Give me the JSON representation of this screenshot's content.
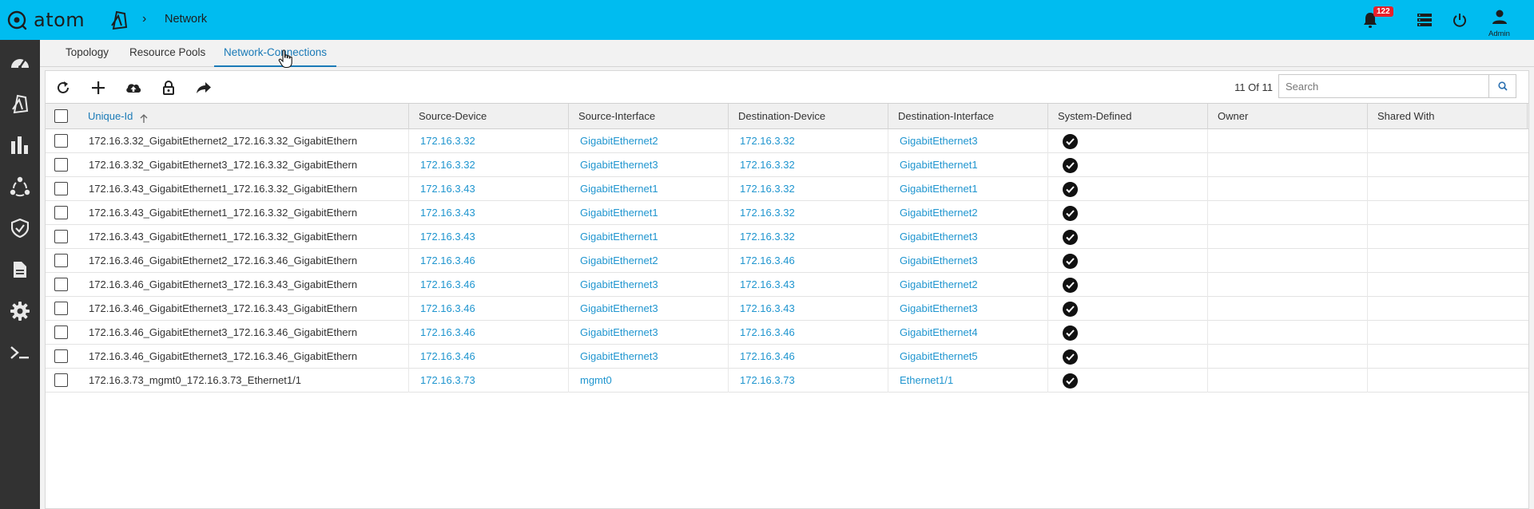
{
  "app": {
    "logo_text": "atom",
    "breadcrumb_current": "Network",
    "notification_count": "122",
    "user_label": "Admin"
  },
  "tabs": [
    {
      "label": "Topology",
      "active": false
    },
    {
      "label": "Resource Pools",
      "active": false
    },
    {
      "label": "Network-Connections",
      "active": true
    }
  ],
  "toolbar": {
    "count": "11 Of 11",
    "search_placeholder": "Search"
  },
  "table": {
    "columns": [
      "Unique-Id",
      "Source-Device",
      "Source-Interface",
      "Destination-Device",
      "Destination-Interface",
      "System-Defined",
      "Owner",
      "Shared With"
    ],
    "sorted_column": "Unique-Id",
    "rows": [
      {
        "uid": "172.16.3.32_GigabitEthernet2_172.16.3.32_GigabitEthern",
        "src_dev": "172.16.3.32",
        "src_if": "GigabitEthernet2",
        "dst_dev": "172.16.3.32",
        "dst_if": "GigabitEthernet3",
        "system": true,
        "owner": "",
        "shared": ""
      },
      {
        "uid": "172.16.3.32_GigabitEthernet3_172.16.3.32_GigabitEthern",
        "src_dev": "172.16.3.32",
        "src_if": "GigabitEthernet3",
        "dst_dev": "172.16.3.32",
        "dst_if": "GigabitEthernet1",
        "system": true,
        "owner": "",
        "shared": ""
      },
      {
        "uid": "172.16.3.43_GigabitEthernet1_172.16.3.32_GigabitEthern",
        "src_dev": "172.16.3.43",
        "src_if": "GigabitEthernet1",
        "dst_dev": "172.16.3.32",
        "dst_if": "GigabitEthernet1",
        "system": true,
        "owner": "",
        "shared": ""
      },
      {
        "uid": "172.16.3.43_GigabitEthernet1_172.16.3.32_GigabitEthern",
        "src_dev": "172.16.3.43",
        "src_if": "GigabitEthernet1",
        "dst_dev": "172.16.3.32",
        "dst_if": "GigabitEthernet2",
        "system": true,
        "owner": "",
        "shared": ""
      },
      {
        "uid": "172.16.3.43_GigabitEthernet1_172.16.3.32_GigabitEthern",
        "src_dev": "172.16.3.43",
        "src_if": "GigabitEthernet1",
        "dst_dev": "172.16.3.32",
        "dst_if": "GigabitEthernet3",
        "system": true,
        "owner": "",
        "shared": ""
      },
      {
        "uid": "172.16.3.46_GigabitEthernet2_172.16.3.46_GigabitEthern",
        "src_dev": "172.16.3.46",
        "src_if": "GigabitEthernet2",
        "dst_dev": "172.16.3.46",
        "dst_if": "GigabitEthernet3",
        "system": true,
        "owner": "",
        "shared": ""
      },
      {
        "uid": "172.16.3.46_GigabitEthernet3_172.16.3.43_GigabitEthern",
        "src_dev": "172.16.3.46",
        "src_if": "GigabitEthernet3",
        "dst_dev": "172.16.3.43",
        "dst_if": "GigabitEthernet2",
        "system": true,
        "owner": "",
        "shared": ""
      },
      {
        "uid": "172.16.3.46_GigabitEthernet3_172.16.3.43_GigabitEthern",
        "src_dev": "172.16.3.46",
        "src_if": "GigabitEthernet3",
        "dst_dev": "172.16.3.43",
        "dst_if": "GigabitEthernet3",
        "system": true,
        "owner": "",
        "shared": ""
      },
      {
        "uid": "172.16.3.46_GigabitEthernet3_172.16.3.46_GigabitEthern",
        "src_dev": "172.16.3.46",
        "src_if": "GigabitEthernet3",
        "dst_dev": "172.16.3.46",
        "dst_if": "GigabitEthernet4",
        "system": true,
        "owner": "",
        "shared": ""
      },
      {
        "uid": "172.16.3.46_GigabitEthernet3_172.16.3.46_GigabitEthern",
        "src_dev": "172.16.3.46",
        "src_if": "GigabitEthernet3",
        "dst_dev": "172.16.3.46",
        "dst_if": "GigabitEthernet5",
        "system": true,
        "owner": "",
        "shared": ""
      },
      {
        "uid": "172.16.3.73_mgmt0_172.16.3.73_Ethernet1/1",
        "src_dev": "172.16.3.73",
        "src_if": "mgmt0",
        "dst_dev": "172.16.3.73",
        "dst_if": "Ethernet1/1",
        "system": true,
        "owner": "",
        "shared": ""
      }
    ]
  },
  "icons": {
    "rail": [
      "dashboard-icon",
      "network-icon",
      "analytics-icon",
      "workflow-icon",
      "compliance-icon",
      "reports-icon",
      "settings-icon",
      "terminal-icon"
    ],
    "toolbar": [
      "refresh-icon",
      "add-icon",
      "upload-icon",
      "lock-icon",
      "share-icon"
    ]
  },
  "colors": {
    "topbar": "#00bcf0",
    "rail": "#323232",
    "link": "#1f95cf",
    "active_tab": "#1a7ab7",
    "badge": "#e8202a"
  }
}
